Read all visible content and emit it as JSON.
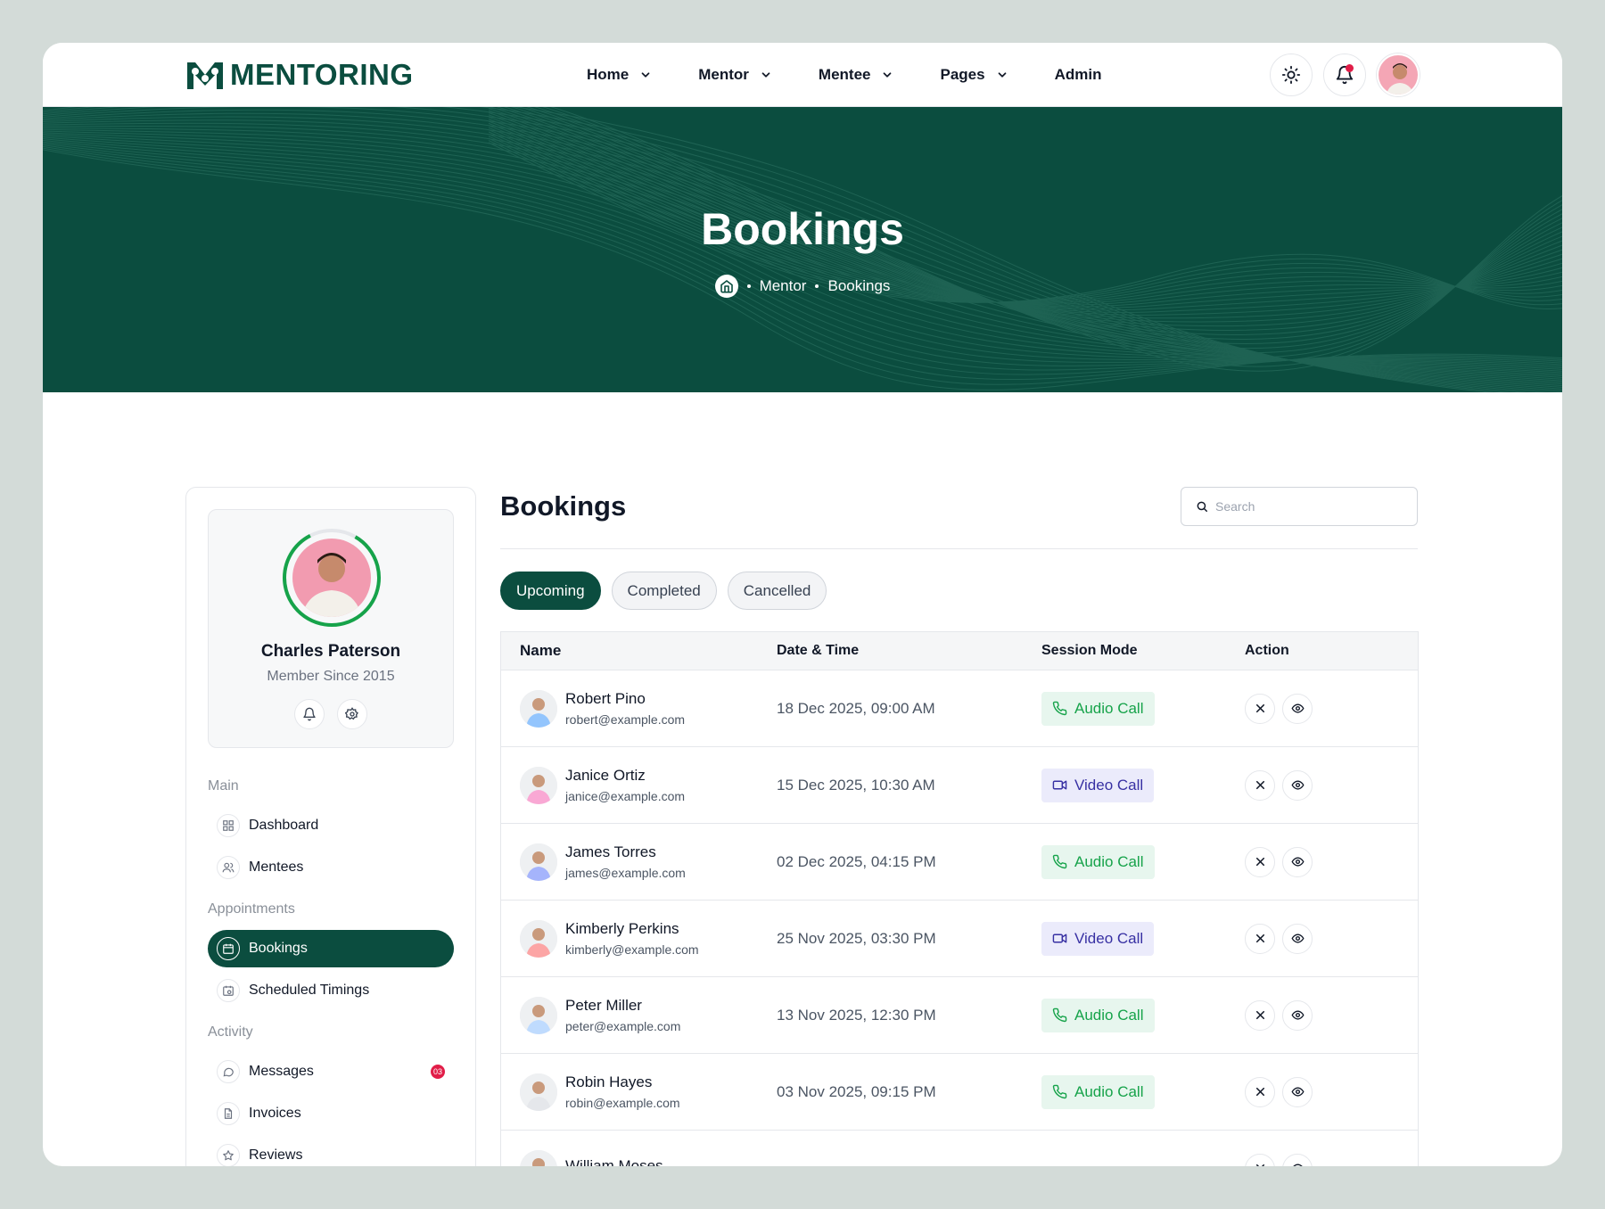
{
  "header": {
    "logo_text": "MENTORING",
    "nav": [
      {
        "label": "Home",
        "dropdown": true
      },
      {
        "label": "Mentor",
        "dropdown": true
      },
      {
        "label": "Mentee",
        "dropdown": true
      },
      {
        "label": "Pages",
        "dropdown": true
      },
      {
        "label": "Admin",
        "dropdown": false
      }
    ],
    "icons": [
      "sun-icon",
      "bell-icon"
    ]
  },
  "hero": {
    "title": "Bookings",
    "breadcrumb": [
      "Mentor",
      "Bookings"
    ]
  },
  "profile": {
    "name": "Charles Paterson",
    "member_since": "Member Since 2015"
  },
  "sidebar": {
    "sections": [
      {
        "title": "Main",
        "items": [
          {
            "label": "Dashboard",
            "icon": "grid-icon"
          },
          {
            "label": "Mentees",
            "icon": "users-icon"
          }
        ]
      },
      {
        "title": "Appointments",
        "items": [
          {
            "label": "Bookings",
            "icon": "calendar-icon",
            "active": true
          },
          {
            "label": "Scheduled Timings",
            "icon": "calendar-clock-icon"
          }
        ]
      },
      {
        "title": "Activity",
        "items": [
          {
            "label": "Messages",
            "icon": "message-icon",
            "badge": "03"
          },
          {
            "label": "Invoices",
            "icon": "file-icon"
          },
          {
            "label": "Reviews",
            "icon": "star-icon"
          }
        ]
      }
    ]
  },
  "main": {
    "title": "Bookings",
    "search_placeholder": "Search",
    "tabs": [
      {
        "label": "Upcoming",
        "active": true
      },
      {
        "label": "Completed",
        "active": false
      },
      {
        "label": "Cancelled",
        "active": false
      }
    ],
    "columns": [
      "Name",
      "Date & Time",
      "Session Mode",
      "Action"
    ],
    "rows": [
      {
        "name": "Robert Pino",
        "email": "robert@example.com",
        "datetime": "18 Dec 2025, 09:00 AM",
        "mode": "Audio Call",
        "mode_type": "audio",
        "avatar_color": "#93c5fd"
      },
      {
        "name": "Janice Ortiz",
        "email": "janice@example.com",
        "datetime": "15 Dec 2025, 10:30 AM",
        "mode": "Video Call",
        "mode_type": "video",
        "avatar_color": "#f9a8d4"
      },
      {
        "name": "James  Torres",
        "email": "james@example.com",
        "datetime": "02 Dec 2025, 04:15 PM",
        "mode": "Audio Call",
        "mode_type": "audio",
        "avatar_color": "#a5b4fc"
      },
      {
        "name": "Kimberly Perkins",
        "email": "kimberly@example.com",
        "datetime": "25 Nov 2025, 03:30 PM",
        "mode": "Video Call",
        "mode_type": "video",
        "avatar_color": "#fca5a5"
      },
      {
        "name": "Peter Miller",
        "email": "peter@example.com",
        "datetime": "13 Nov 2025, 12:30 PM",
        "mode": "Audio Call",
        "mode_type": "audio",
        "avatar_color": "#bfdbfe"
      },
      {
        "name": "Robin Hayes",
        "email": "robin@example.com",
        "datetime": "03 Nov 2025, 09:15 PM",
        "mode": "Audio Call",
        "mode_type": "audio",
        "avatar_color": "#e5e7eb"
      },
      {
        "name": "William Moses",
        "email": "",
        "datetime": "",
        "mode": "",
        "mode_type": "video",
        "avatar_color": "#d1d5db"
      }
    ]
  },
  "colors": {
    "brand": "#0b4d3f",
    "audio": "#16a34a",
    "video": "#3730a3",
    "badge": "#e11d48"
  }
}
